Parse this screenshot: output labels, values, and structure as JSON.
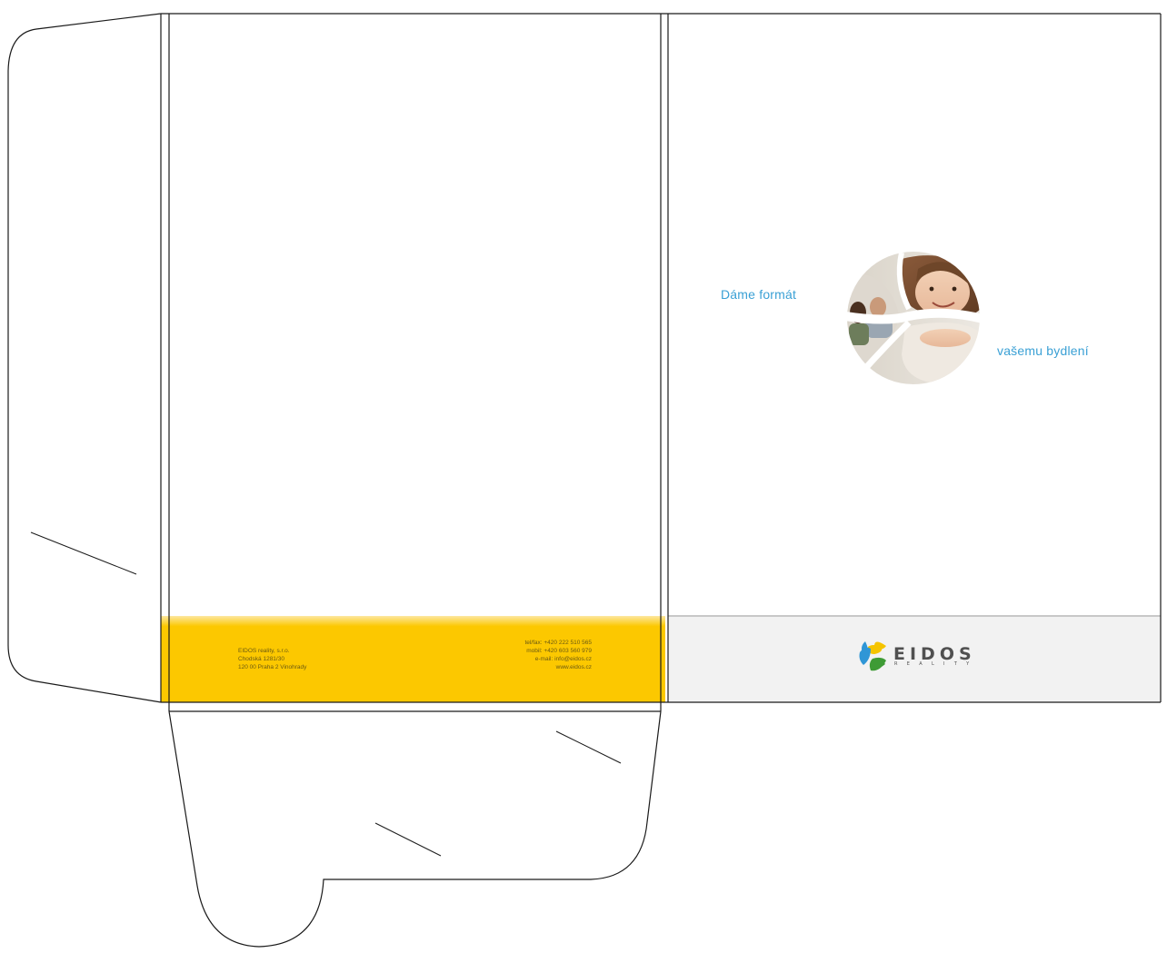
{
  "colors": {
    "outline": "#1a1a1a",
    "back_band": "#fcc800",
    "front_band": "#f2f2f2",
    "tagline": "#3aa0d5",
    "logo_text": "#505050",
    "logo_yellow": "#f5c400",
    "logo_blue": "#2f96d6",
    "logo_green": "#3e9b35"
  },
  "back_footer": {
    "address": [
      "EIDOS reality, s.r.o.",
      "Chodská 1281/30",
      "120 00 Praha 2 Vinohrady"
    ],
    "contacts": [
      "tel/fax: +420 222 510 565",
      "mobil: +420 603 560 979",
      "e-mail: info@eidos.cz",
      "www.eidos.cz"
    ]
  },
  "front_cover": {
    "tagline_1": "Dáme formát",
    "tagline_2": "vašemu bydlení",
    "photo_icon": "family-photo-petal-icon"
  },
  "logo": {
    "name": "EIDOS",
    "sub": "REALITY",
    "icon": "eidos-petal-logo-icon"
  }
}
